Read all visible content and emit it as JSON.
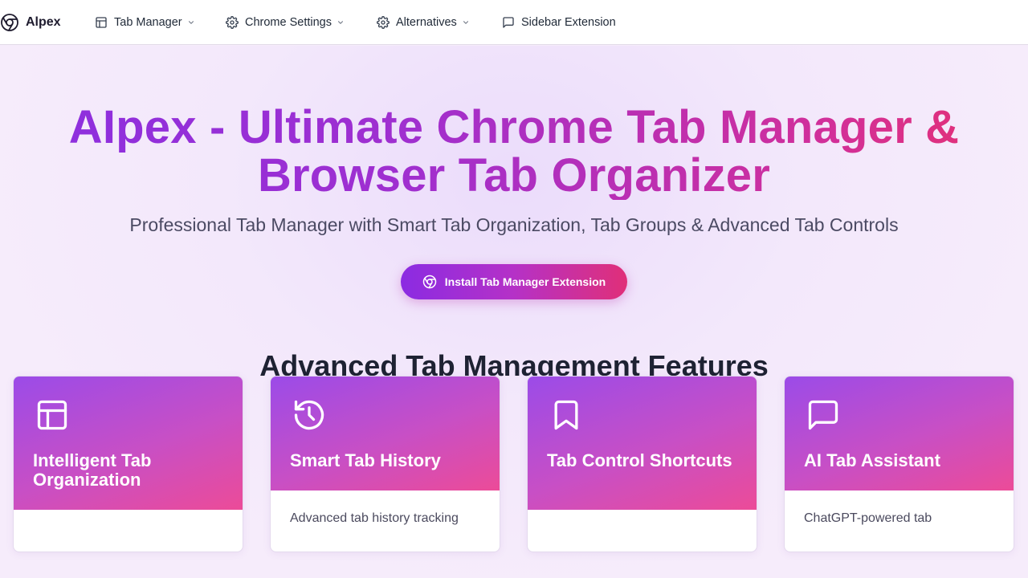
{
  "brand": {
    "name": "Alpex",
    "icon": "chrome-icon"
  },
  "nav": {
    "items": [
      {
        "label": "Tab Manager",
        "icon": "layout-icon",
        "dropdown": true
      },
      {
        "label": "Chrome Settings",
        "icon": "gear-icon",
        "dropdown": true
      },
      {
        "label": "Alternatives",
        "icon": "gear-icon",
        "dropdown": true
      },
      {
        "label": "Sidebar Extension",
        "icon": "message-icon",
        "dropdown": false
      }
    ]
  },
  "hero": {
    "title_line1": "AIpex - Ultimate Chrome Tab Manager &",
    "title_line2": "Browser Tab Organizer",
    "subtitle": "Professional Tab Manager with Smart Tab Organization, Tab Groups & Advanced Tab Controls",
    "cta_label": "Install Tab Manager Extension",
    "cta_icon": "chrome-icon"
  },
  "features": {
    "heading": "Advanced Tab Management Features",
    "cards": [
      {
        "title": "Intelligent Tab Organization",
        "icon": "layout-icon",
        "description": ""
      },
      {
        "title": "Smart Tab History",
        "icon": "history-icon",
        "description": "Advanced tab history tracking"
      },
      {
        "title": "Tab Control Shortcuts",
        "icon": "bookmark-icon",
        "description": ""
      },
      {
        "title": "AI Tab Assistant",
        "icon": "message-icon",
        "description": "ChatGPT-powered tab"
      }
    ]
  },
  "colors": {
    "accent_start": "#8b2be2",
    "accent_end": "#e02f78",
    "text_dark": "#1e2233",
    "page_bg": "#f6ecfb"
  }
}
